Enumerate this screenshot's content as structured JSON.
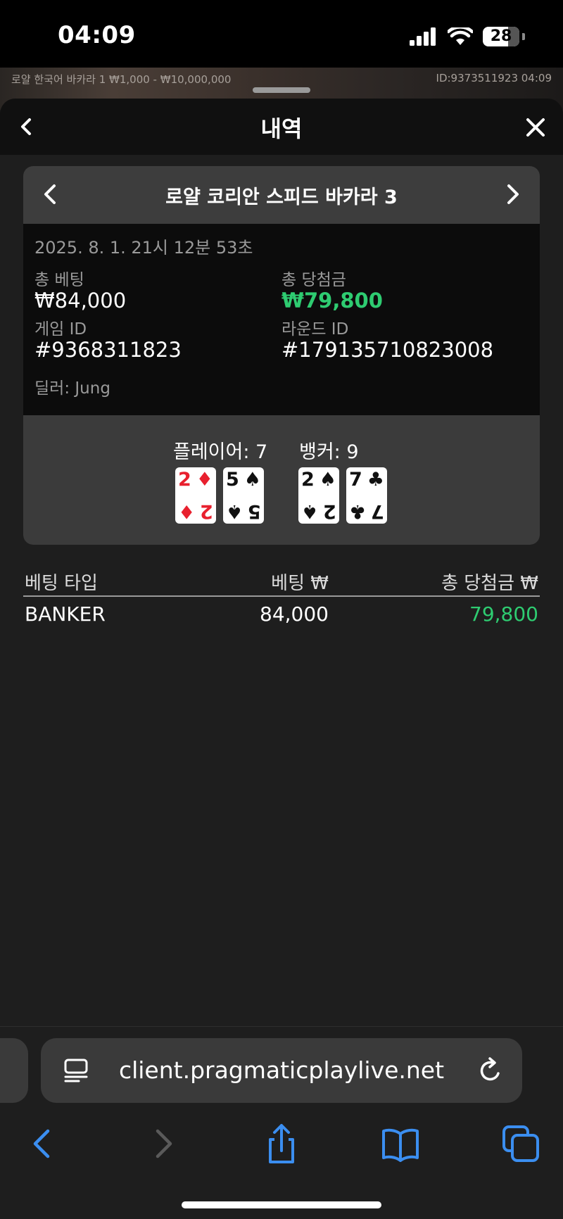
{
  "status": {
    "time": "04:09",
    "battery": "28"
  },
  "game_strip": {
    "left": "로얄 한국어 바카라 1  ₩1,000 - ₩10,000,000",
    "right": "ID:9373511923  04:09"
  },
  "header": {
    "title": "내역"
  },
  "card": {
    "title": "로얄 코리안 스피드 바카라 3",
    "date": "2025. 8. 1. 21시 12분 53초",
    "total_bet_label": "총 베팅",
    "total_bet_value": "₩84,000",
    "total_win_label": "총 당첨금",
    "total_win_value": "₩79,800",
    "game_id_label": "게임 ID",
    "game_id_value": "#9368311823",
    "round_id_label": "라운드 ID",
    "round_id_value": "#179135710823008",
    "dealer": "딜러: Jung",
    "player_score": "플레이어: 7",
    "banker_score": "뱅커: 9",
    "player_cards": [
      {
        "rank": "2",
        "suit": "♦",
        "color": "#e8202e"
      },
      {
        "rank": "5",
        "suit": "♠",
        "color": "#111111"
      }
    ],
    "banker_cards": [
      {
        "rank": "2",
        "suit": "♠",
        "color": "#111111"
      },
      {
        "rank": "7",
        "suit": "♣",
        "color": "#111111"
      }
    ]
  },
  "bets_table": {
    "headers": [
      "베팅 타입",
      "베팅 ₩",
      "총 당첨금 ₩"
    ],
    "rows": [
      {
        "type": "BANKER",
        "bet": "84,000",
        "win": "79,800"
      }
    ]
  },
  "browser": {
    "url": "client.pragmaticplaylive.net"
  },
  "colors": {
    "win_green": "#2ecc71",
    "accent_blue": "#3b8ef0"
  }
}
